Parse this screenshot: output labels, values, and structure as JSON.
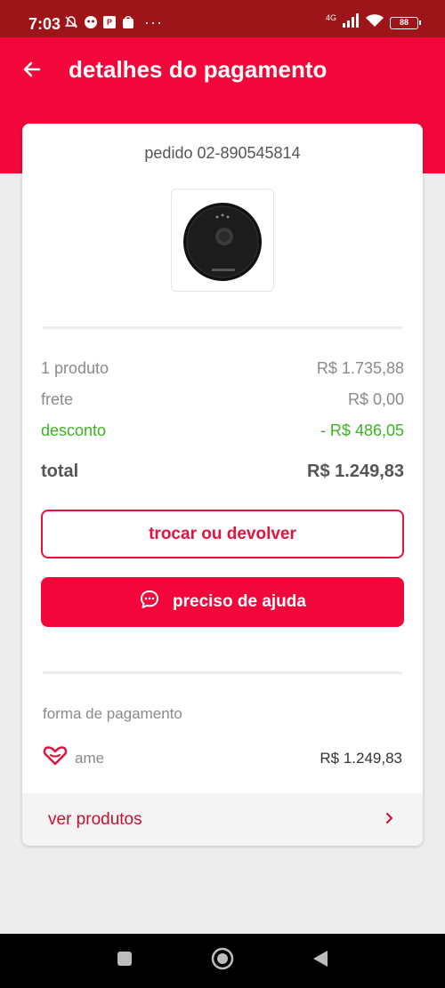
{
  "status_bar": {
    "time": "7:03",
    "network": "4G",
    "battery": "88",
    "icons": [
      "bell-off-icon",
      "app-icon",
      "p-icon",
      "shopping-bag-icon",
      "more-dots-icon",
      "signal-icon",
      "wifi-icon",
      "battery-icon"
    ]
  },
  "header": {
    "title": "detalhes do pagamento",
    "back_icon": "arrow-left-icon"
  },
  "order": {
    "number": "pedido 02-890545814",
    "product_image": "robot-vacuum"
  },
  "summary": {
    "rows": [
      {
        "label": "1 produto",
        "value": "R$ 1.735,88"
      },
      {
        "label": "frete",
        "value": "R$ 0,00"
      },
      {
        "label": "desconto",
        "value": "- R$ 486,05"
      }
    ],
    "total_label": "total",
    "total_value": "R$ 1.249,83"
  },
  "actions": {
    "return_label": "trocar ou devolver",
    "help_label": "preciso de ajuda",
    "help_icon": "chat-bubble-icon"
  },
  "payment": {
    "heading": "forma de pagamento",
    "method": "ame",
    "method_icon": "ame-heart-icon",
    "amount": "R$ 1.249,83"
  },
  "products_link": {
    "label": "ver produtos",
    "icon": "chevron-right-icon"
  },
  "colors": {
    "brand_red": "#f3073a",
    "status_bar": "#9d1518",
    "discount_green": "#3db324"
  }
}
